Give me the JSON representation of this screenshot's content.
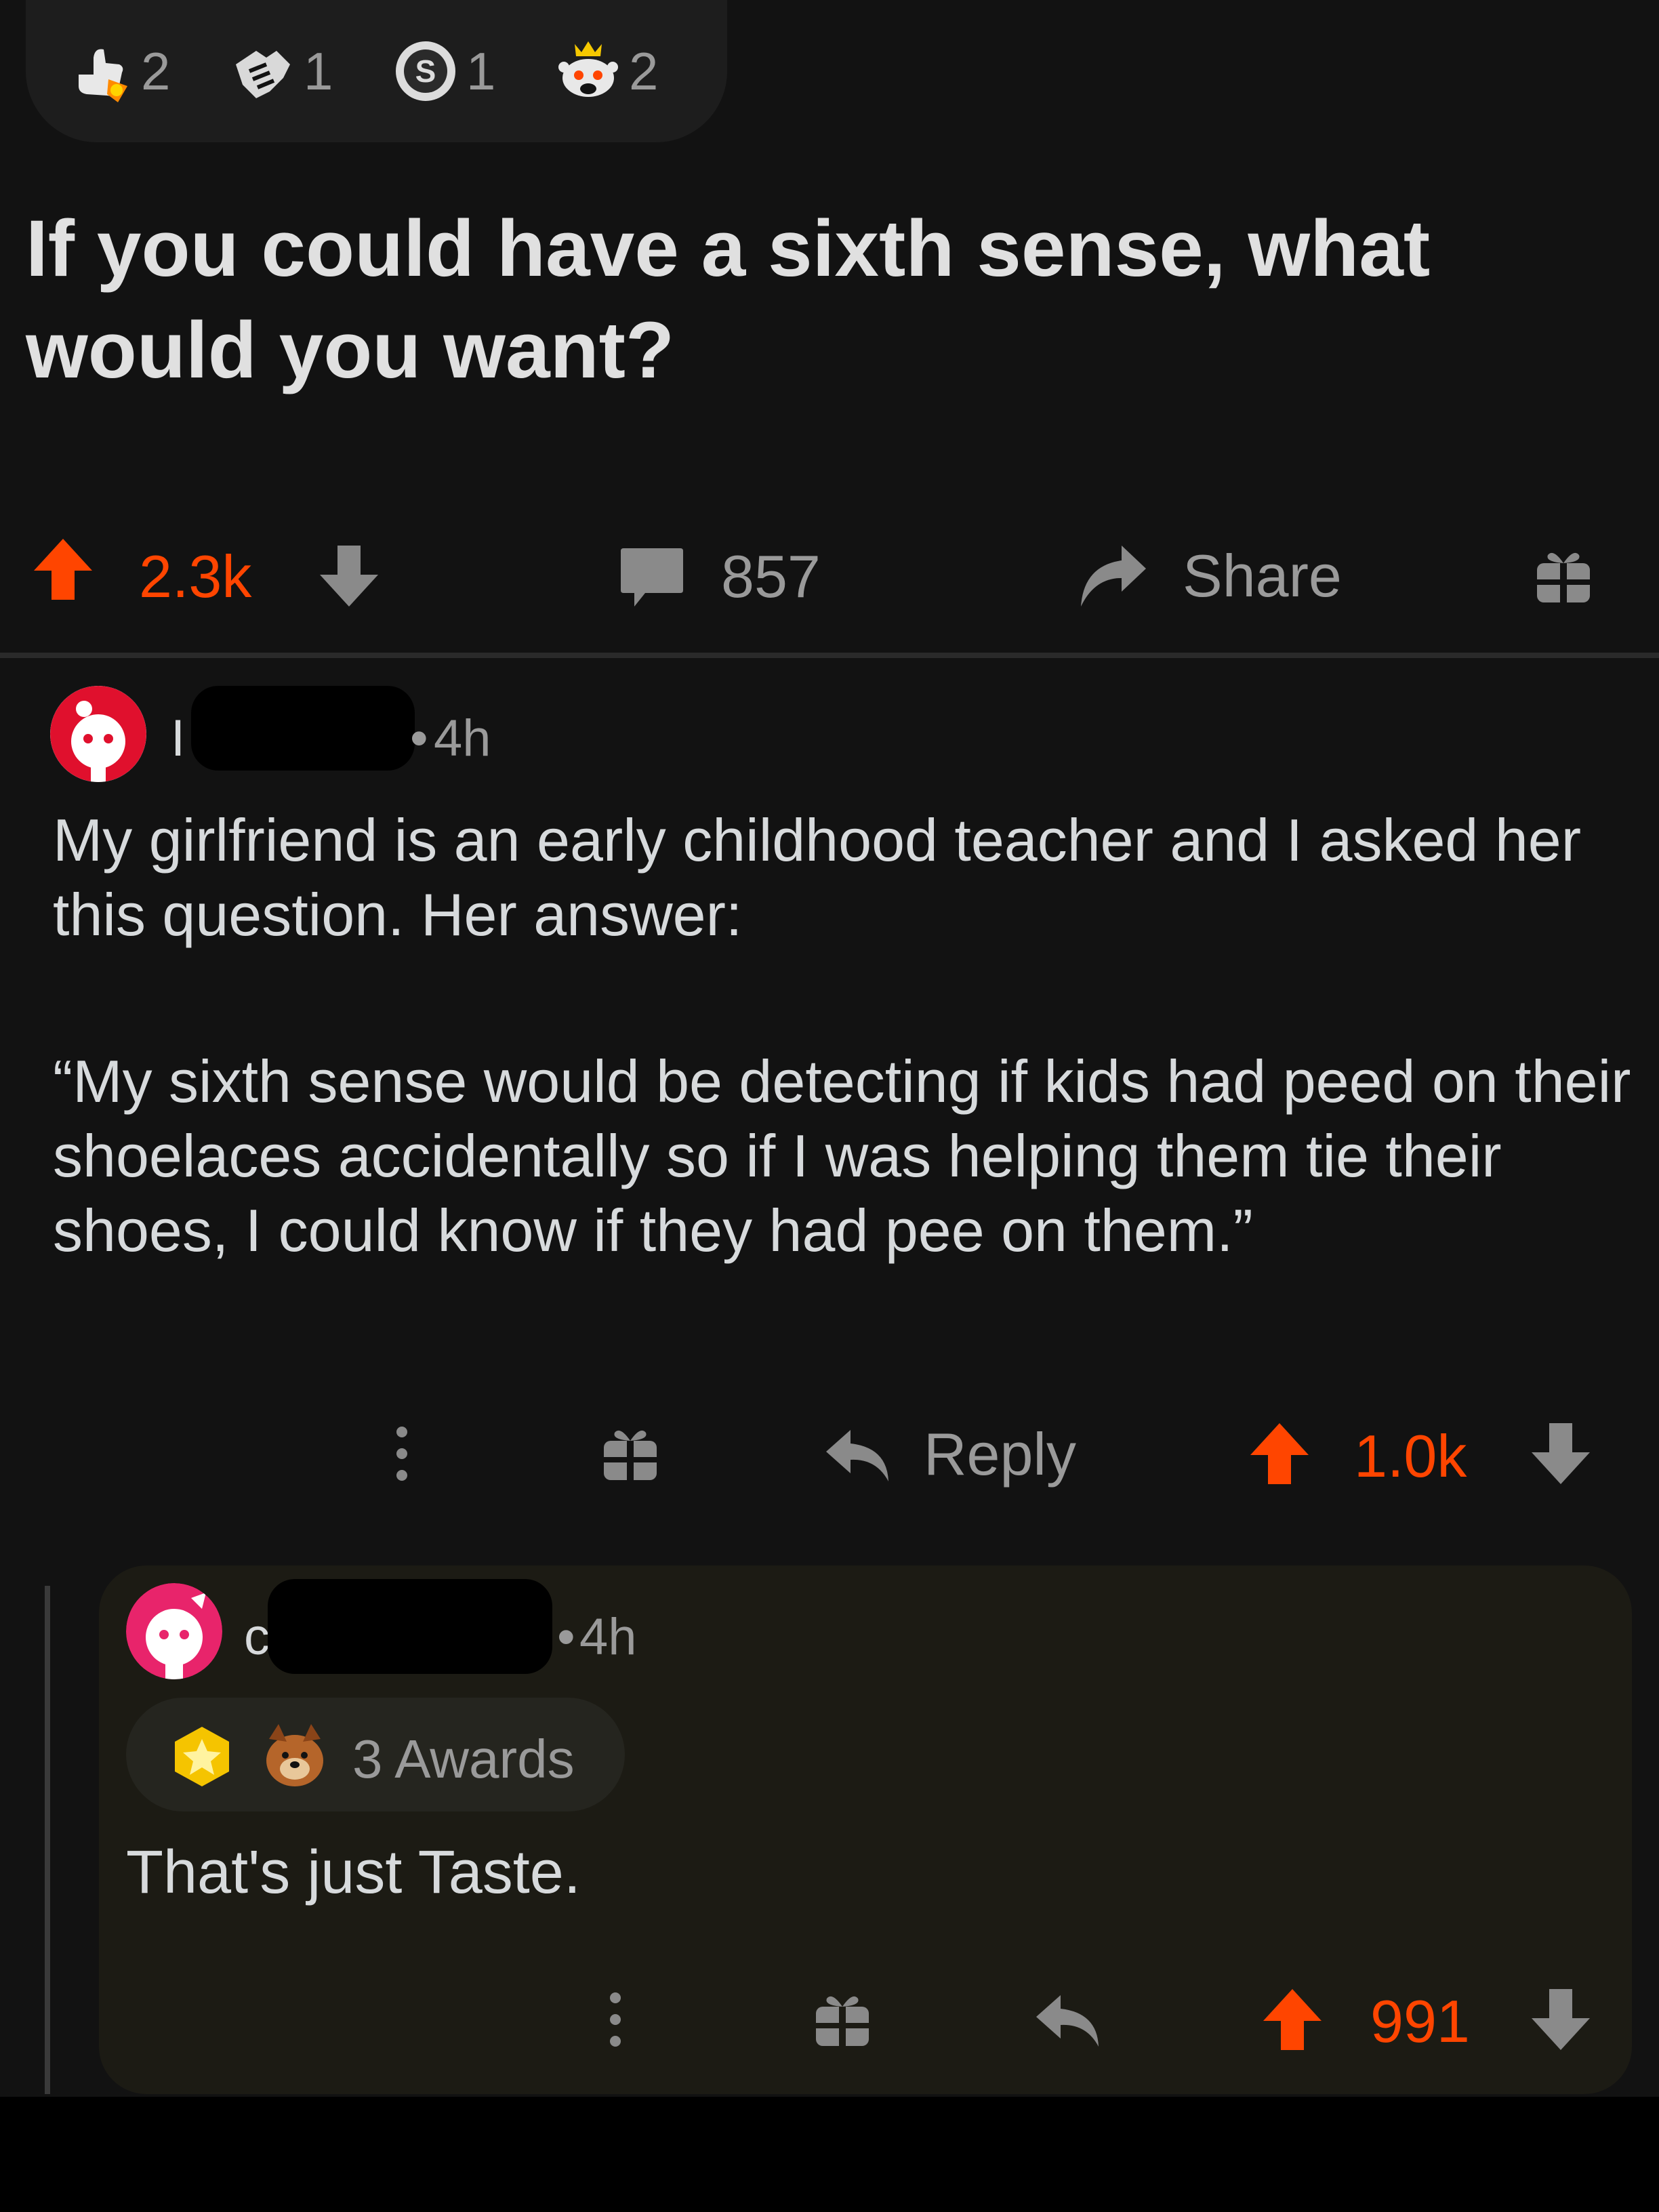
{
  "post": {
    "awards": [
      {
        "icon": "thumbs-up-rocket-icon",
        "count": "2"
      },
      {
        "icon": "handshake-icon",
        "count": "1"
      },
      {
        "icon": "silver-coin-icon",
        "count": "1"
      },
      {
        "icon": "crowned-snoo-icon",
        "count": "2"
      }
    ],
    "title": "If you could have a sixth sense, what would you want?",
    "score": "2.3k",
    "comments": "857",
    "share_label": "Share"
  },
  "comment": {
    "username_visible": "I",
    "time": "4h",
    "paragraphs": [
      "My girlfriend is an early childhood teacher and I asked her this question. Her answer:",
      "“My sixth sense would be detecting if kids had peed on their shoelaces accidentally so if I was helping them tie their shoes, I could know if they had pee on them.”"
    ],
    "reply_label": "Reply",
    "score": "1.0k"
  },
  "reply": {
    "username_visible": "c.",
    "time": "4h",
    "awards_label": "3 Awards",
    "body": "That's just Taste.",
    "score": "991"
  },
  "colors": {
    "background": "#121212",
    "upvote": "#ff4500",
    "muted": "#9a9a9a",
    "text": "#d7dadc"
  }
}
